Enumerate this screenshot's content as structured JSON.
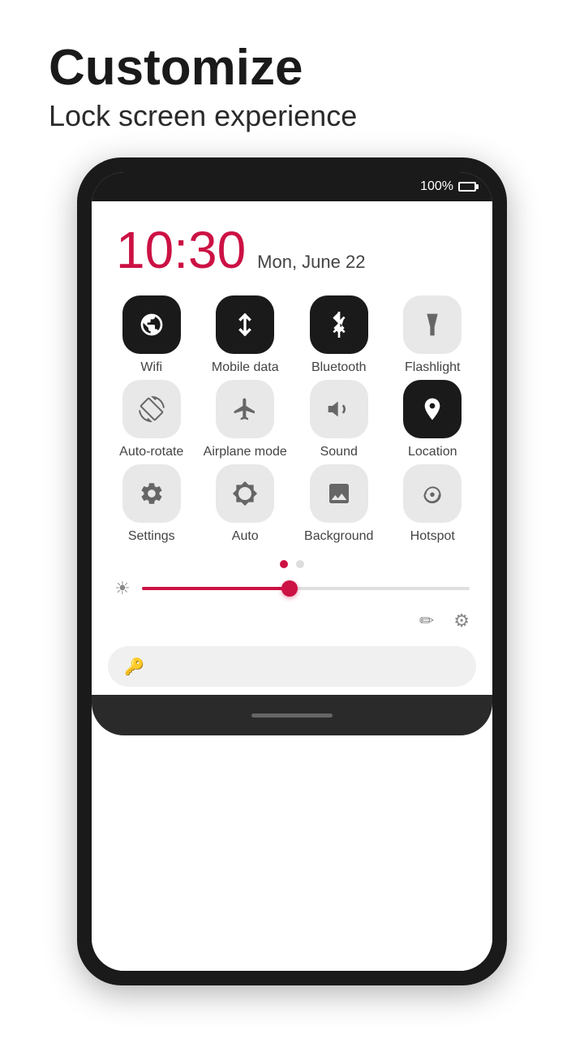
{
  "header": {
    "title": "Customize",
    "subtitle": "Lock screen experience"
  },
  "phone": {
    "battery_pct": "100%",
    "clock": {
      "time": "10:30",
      "date": "Mon, June 22"
    },
    "tiles_row1": [
      {
        "id": "wifi",
        "label": "Wifi",
        "state": "active"
      },
      {
        "id": "mobile_data",
        "label": "Mobile data",
        "state": "active"
      },
      {
        "id": "bluetooth",
        "label": "Bluetooth",
        "state": "active"
      },
      {
        "id": "flashlight",
        "label": "Flashlight",
        "state": "inactive"
      }
    ],
    "tiles_row2": [
      {
        "id": "auto_rotate",
        "label": "Auto-rotate",
        "state": "inactive"
      },
      {
        "id": "airplane_mode",
        "label": "Airplane mode",
        "state": "inactive"
      },
      {
        "id": "sound",
        "label": "Sound",
        "state": "inactive"
      },
      {
        "id": "location",
        "label": "Location",
        "state": "active"
      }
    ],
    "tiles_row3": [
      {
        "id": "settings",
        "label": "Settings",
        "state": "inactive"
      },
      {
        "id": "auto",
        "label": "Auto",
        "state": "inactive"
      },
      {
        "id": "background",
        "label": "Background",
        "state": "inactive"
      },
      {
        "id": "hotspot",
        "label": "Hotspot",
        "state": "inactive"
      }
    ],
    "dots": [
      {
        "active": true
      },
      {
        "active": false
      }
    ],
    "brightness": 45
  }
}
